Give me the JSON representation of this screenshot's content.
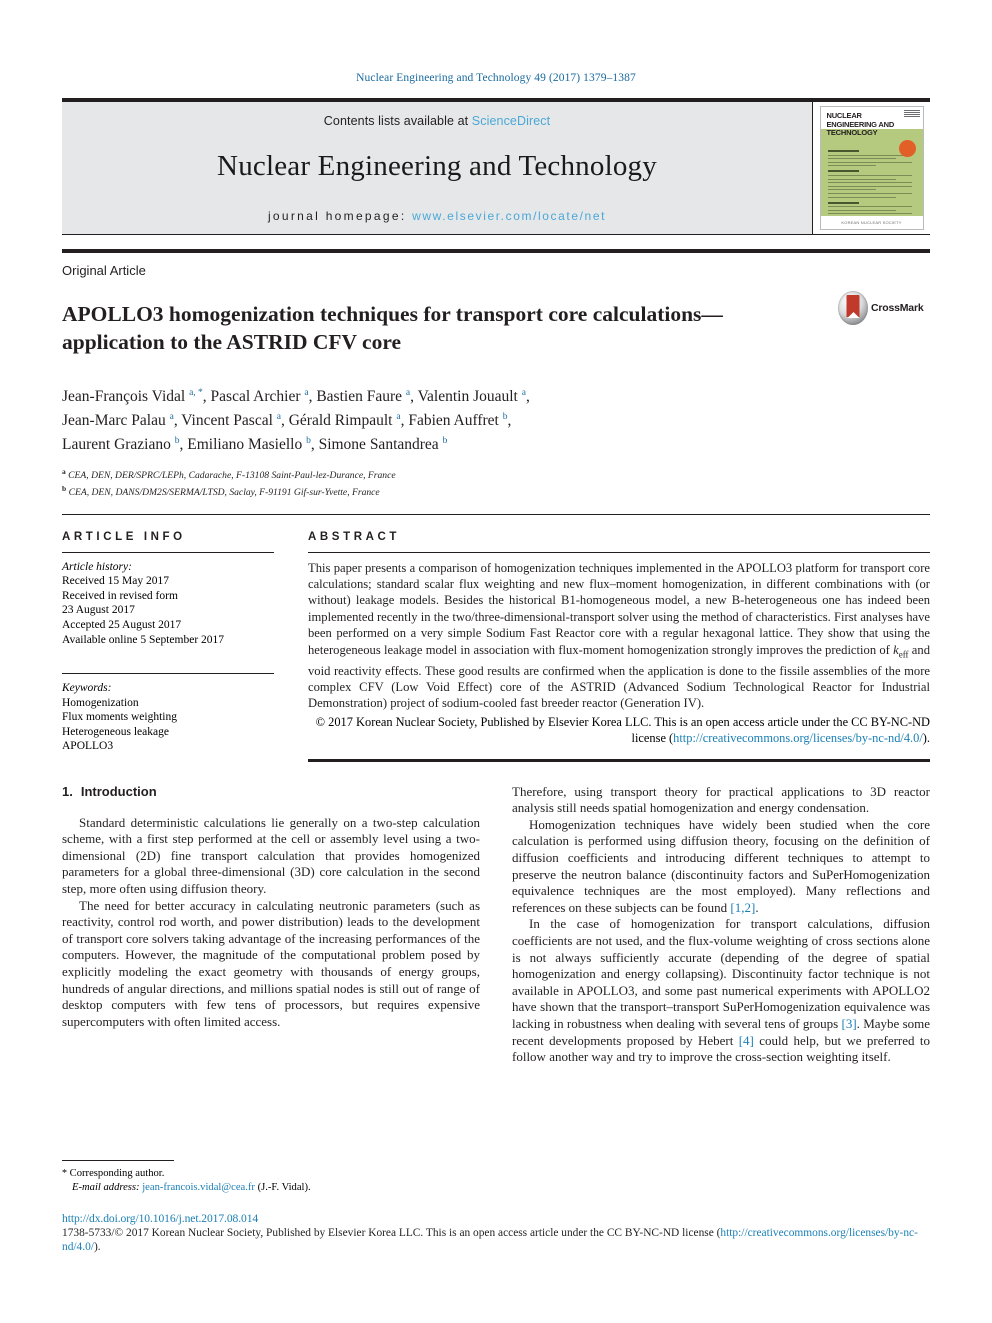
{
  "running_head": "Nuclear Engineering and Technology 49 (2017) 1379–1387",
  "masthead": {
    "contents_prefix": "Contents lists available at ",
    "sciencedirect": "ScienceDirect",
    "journal_title": "Nuclear Engineering and Technology",
    "homepage_label": "journal homepage:",
    "homepage_url": "www.elsevier.com/locate/net",
    "cover": {
      "title": "NUCLEAR ENGINEERING AND TECHNOLOGY",
      "footer_text": "KOREAN NUCLEAR SOCIETY"
    }
  },
  "article": {
    "type": "Original Article",
    "title": "APOLLO3 homogenization techniques for transport core calculations—application to the ASTRID CFV core",
    "crossmark_label": "CrossMark",
    "authors_line_1": "Jean-François Vidal a, *, Pascal Archier a, Bastien Faure a, Valentin Jouault a,",
    "authors_line_2": "Jean-Marc Palau a, Vincent Pascal a, Gérald Rimpault a, Fabien Auffret b,",
    "authors_line_3": "Laurent Graziano b, Emiliano Masiello b, Simone Santandrea b",
    "affiliations": [
      {
        "marker": "a",
        "text": "CEA, DEN, DER/SPRC/LEPh, Cadarache, F-13108 Saint-Paul-lez-Durance, France"
      },
      {
        "marker": "b",
        "text": "CEA, DEN, DANS/DM2S/SERMA/LTSD, Saclay, F-91191 Gif-sur-Yvette, France"
      }
    ]
  },
  "info": {
    "heading": "ARTICLE INFO",
    "history_label": "Article history:",
    "history": [
      "Received 15 May 2017",
      "Received in revised form",
      "23 August 2017",
      "Accepted 25 August 2017",
      "Available online 5 September 2017"
    ],
    "keywords_label": "Keywords:",
    "keywords": [
      "Homogenization",
      "Flux moments weighting",
      "Heterogeneous leakage",
      "APOLLO3"
    ]
  },
  "abstract": {
    "heading": "ABSTRACT",
    "part1": "This paper presents a comparison of homogenization techniques implemented in the APOLLO3 platform for transport core calculations; standard scalar flux weighting and new flux–moment homogenization, in different combinations with (or without) leakage models. Besides the historical B1-homogeneous model, a new B-heterogeneous one has indeed been implemented recently in the two/three-dimensional-transport solver using the method of characteristics. First analyses have been performed on a very simple Sodium Fast Reactor core with a regular hexagonal lattice. They show that using the heterogeneous leakage model in association with flux-moment homogenization strongly improves the prediction of ",
    "keff_base": "k",
    "keff_sub": "eff",
    "part2": " and void reactivity effects. These good results are confirmed when the application is done to the fissile assemblies of the more complex CFV (Low Void Effect) core of the ASTRID (Advanced Sodium Technological Reactor for Industrial Demonstration) project of sodium-cooled fast breeder reactor (Generation IV).",
    "copyright": "© 2017 Korean Nuclear Society, Published by Elsevier Korea LLC. This is an open access article under the CC BY-NC-ND license (",
    "license_url": "http://creativecommons.org/licenses/by-nc-nd/4.0/",
    "copyright_tail": ")."
  },
  "body": {
    "section_number": "1.",
    "section_title": "Introduction",
    "left_paragraphs": [
      "Standard deterministic calculations lie generally on a two-step calculation scheme, with a first step performed at the cell or assembly level using a two-dimensional (2D) fine transport calculation that provides homogenized parameters for a global three-dimensional (3D) core calculation in the second step, more often using diffusion theory.",
      "The need for better accuracy in calculating neutronic parameters (such as reactivity, control rod worth, and power distribution) leads to the development of transport core solvers taking advantage of the increasing performances of the computers. However, the magnitude of the computational problem posed by explicitly modeling the exact geometry with thousands of energy groups, hundreds of angular directions, and millions spatial nodes is still out of range of desktop computers with few tens of processors, but requires expensive supercomputers with often limited access."
    ],
    "right_paragraphs": [
      {
        "indent": false,
        "segments": [
          {
            "type": "text",
            "value": "Therefore, using transport theory for practical applications to 3D reactor analysis still needs spatial homogenization and energy condensation."
          }
        ]
      },
      {
        "indent": true,
        "segments": [
          {
            "type": "text",
            "value": "Homogenization techniques have widely been studied when the core calculation is performed using diffusion theory, focusing on the definition of diffusion coefficients and introducing different techniques to attempt to preserve the neutron balance (discontinuity factors and SuPerHomogenization equivalence techniques are the most employed). Many reflections and references on these subjects can be found "
          },
          {
            "type": "ref",
            "value": "[1,2]"
          },
          {
            "type": "text",
            "value": "."
          }
        ]
      },
      {
        "indent": true,
        "segments": [
          {
            "type": "text",
            "value": "In the case of homogenization for transport calculations, diffusion coefficients are not used, and the flux-volume weighting of cross sections alone is not always sufficiently accurate (depending of the degree of spatial homogenization and energy collapsing). Discontinuity factor technique is not available in APOLLO3, and some past numerical experiments with APOLLO2 have shown that the transport–transport SuPerHomogenization equivalence was lacking in robustness when dealing with several tens of groups "
          },
          {
            "type": "ref",
            "value": "[3]"
          },
          {
            "type": "text",
            "value": ". Maybe some recent developments proposed by Hebert "
          },
          {
            "type": "ref",
            "value": "[4]"
          },
          {
            "type": "text",
            "value": " could help, but we preferred to follow another way and try to improve the cross-section weighting itself."
          }
        ]
      }
    ]
  },
  "footnote": {
    "corresponding": "Corresponding author.",
    "email_label": "E-mail address:",
    "email": "jean-francois.vidal@cea.fr",
    "email_tail": "(J.-F. Vidal)."
  },
  "footer": {
    "doi": "http://dx.doi.org/10.1016/j.net.2017.08.014",
    "issn_prefix": "1738-5733/© 2017 Korean Nuclear Society, Published by Elsevier Korea LLC. This is an open access article under the CC BY-NC-ND license (",
    "license_url": "http://creativecommons.org/licenses/by-nc-nd/4.0/",
    "issn_tail": ")."
  },
  "colors": {
    "link": "#1a7fb5",
    "running_head": "#1a6a9e",
    "sciencedirect": "#4aa8d8",
    "masthead_bg": "#e6e7e8"
  }
}
